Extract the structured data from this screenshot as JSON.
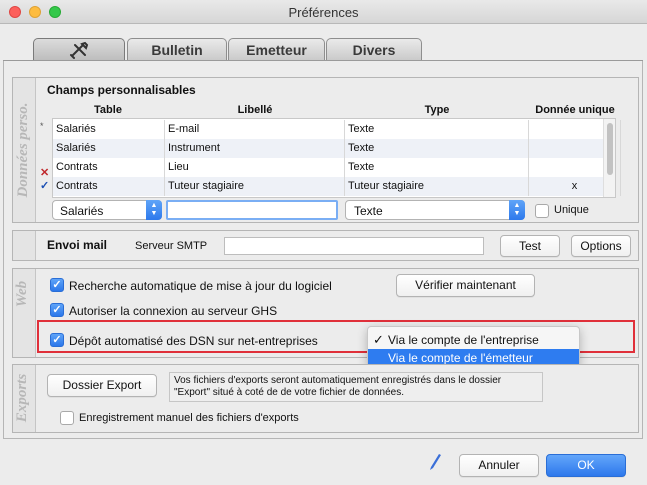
{
  "window": {
    "title": "Préférences"
  },
  "tabs": {
    "t1_icon": "tools-icon",
    "t2": "Bulletin",
    "t3": "Emetteur",
    "t4": "Divers"
  },
  "sections": {
    "donnees": "Données perso.",
    "web": "Web",
    "exports": "Exports"
  },
  "champs": {
    "title": "Champs personnalisables",
    "headers": {
      "table": "Table",
      "libelle": "Libellé",
      "type": "Type",
      "unique": "Donnée unique"
    },
    "rows": [
      {
        "table": "Salariés",
        "libelle": "E-mail",
        "type": "Texte",
        "unique": ""
      },
      {
        "table": "Salariés",
        "libelle": "Instrument",
        "type": "Texte",
        "unique": ""
      },
      {
        "table": "Contrats",
        "libelle": "Lieu",
        "type": "Texte",
        "unique": ""
      },
      {
        "table": "Contrats",
        "libelle": "Tuteur stagiaire",
        "type": "Tuteur stagiaire",
        "unique": "x"
      }
    ],
    "edit": {
      "table": "Salariés",
      "libelle": "",
      "type": "Texte",
      "unique_label": "Unique"
    }
  },
  "mail": {
    "title": "Envoi mail",
    "smtp_label": "Serveur SMTP",
    "smtp_value": "",
    "test_button": "Test",
    "options_button": "Options"
  },
  "web": {
    "auto_update": "Recherche automatique de mise à jour du logiciel",
    "verify_button": "Vérifier maintenant",
    "ghs": "Autoriser la connexion au serveur GHS",
    "dsn": "Dépôt automatisé des DSN sur net-entreprises",
    "menu_items": [
      "Via le compte de l'entreprise",
      "Via le compte de l'émetteur"
    ],
    "checkmark": "✓"
  },
  "exports": {
    "button": "Dossier Export",
    "info": "Vos fichiers d'exports seront automatiquement enregistrés dans le dossier \"Export\" situé à coté de de votre fichier de données.",
    "manual": "Enregistrement manuel des fichiers d'exports"
  },
  "footer": {
    "cancel": "Annuler",
    "ok": "OK"
  },
  "colors": {
    "accent": "#2e7cf0",
    "highlight": "#e0303a"
  }
}
